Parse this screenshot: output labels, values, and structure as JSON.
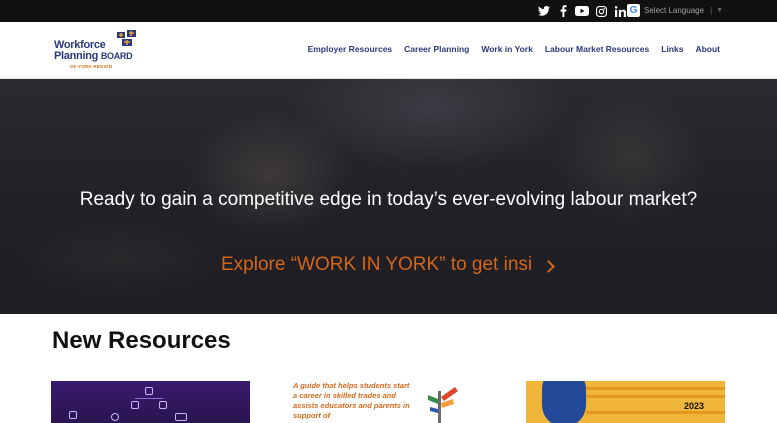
{
  "topbar": {
    "social_icons": [
      "twitter-icon",
      "facebook-icon",
      "youtube-icon",
      "instagram-icon",
      "linkedin-icon"
    ],
    "language_selector": "Select Language",
    "google_glyph": "G"
  },
  "header": {
    "logo_line1": "Workforce",
    "logo_line2_prefix": "Planning ",
    "logo_line2_suffix": "BOARD",
    "logo_line3": "OF YORK REGION",
    "nav": [
      "Employer Resources",
      "Career Planning",
      "Work in York",
      "Labour Market Resources",
      "Links",
      "About"
    ]
  },
  "hero": {
    "heading": "Ready to gain a competitive edge in today’s ever-evolving labour market?",
    "cta": "Explore “WORK IN YORK” to get insi"
  },
  "resources": {
    "title": "New Resources",
    "card2_text": "A guide that helps students start a career in skilled trades and assists educators and parents in support of",
    "card3_year": "2023"
  },
  "colors": {
    "brand_navy": "#2b3a7a",
    "accent_orange": "#d4661a",
    "topbar": "#111111"
  }
}
